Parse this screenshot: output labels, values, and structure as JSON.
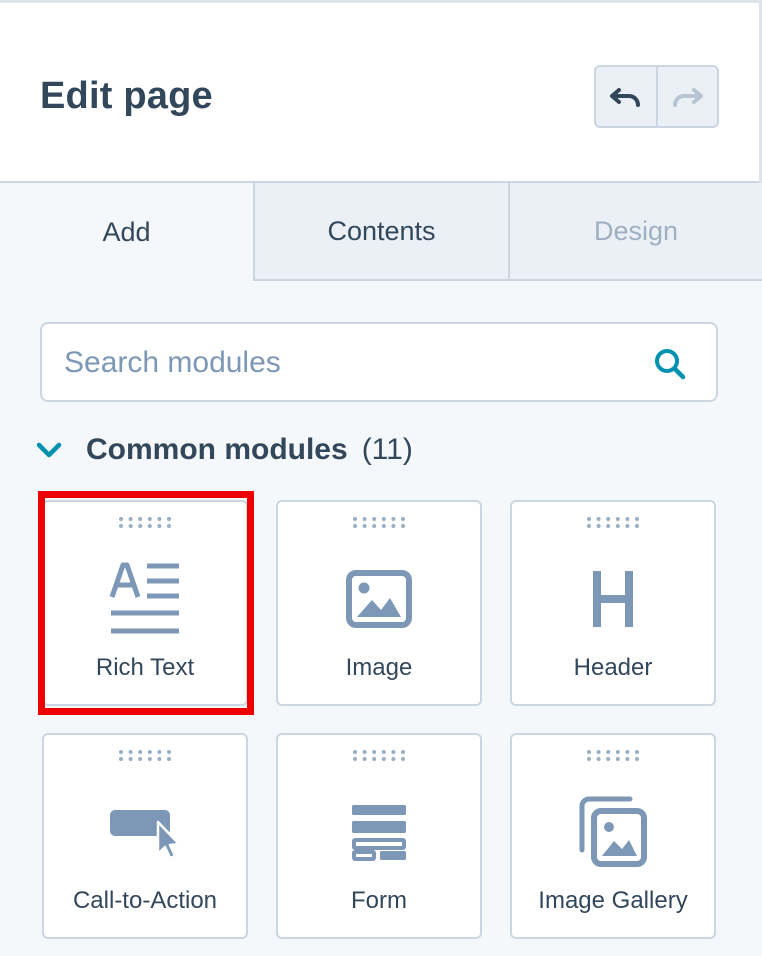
{
  "header": {
    "title": "Edit page"
  },
  "tabs": [
    {
      "label": "Add"
    },
    {
      "label": "Contents"
    },
    {
      "label": "Design"
    }
  ],
  "search": {
    "placeholder": "Search modules",
    "value": ""
  },
  "section": {
    "title": "Common modules",
    "count": "(11)"
  },
  "modules": [
    {
      "label": "Rich Text",
      "icon": "rich-text-icon"
    },
    {
      "label": "Image",
      "icon": "image-icon"
    },
    {
      "label": "Header",
      "icon": "header-icon"
    },
    {
      "label": "Call-to-Action",
      "icon": "call-to-action-icon"
    },
    {
      "label": "Form",
      "icon": "form-icon"
    },
    {
      "label": "Image Gallery",
      "icon": "image-gallery-icon"
    }
  ],
  "colors": {
    "text": "#33475b",
    "icon": "#7c98b6",
    "accent": "#00a4bd",
    "highlight": "#ee0000",
    "border": "#cbd6e2"
  }
}
